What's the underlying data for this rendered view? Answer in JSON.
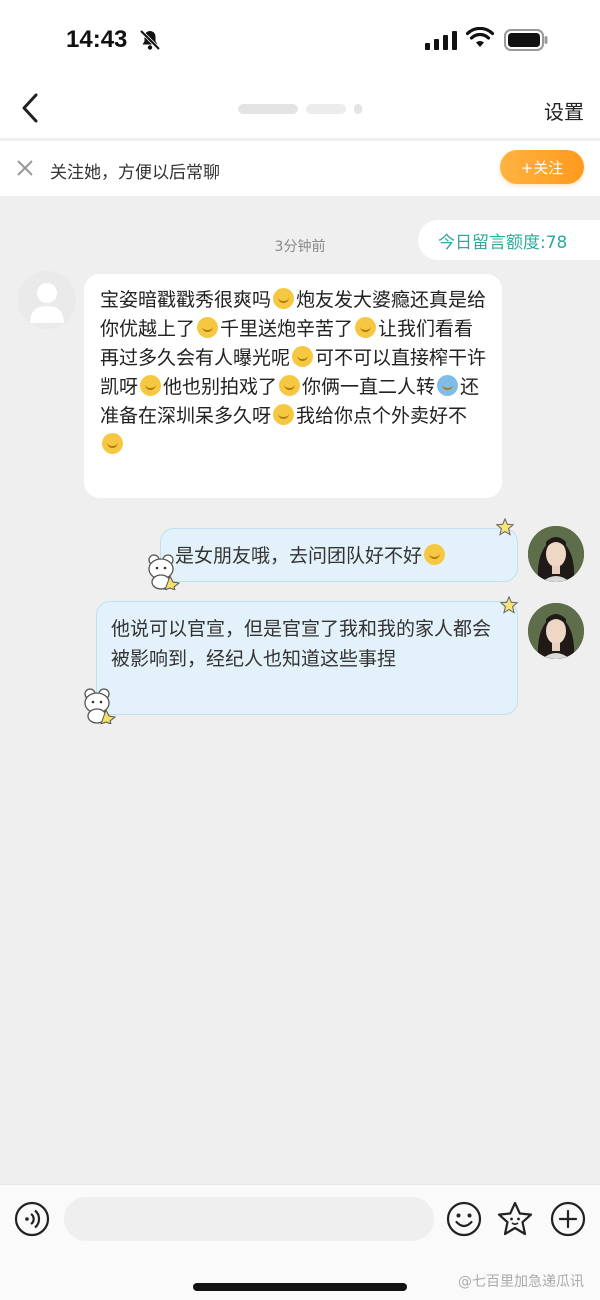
{
  "status_bar": {
    "time": "14:43"
  },
  "nav": {
    "settings_label": "设置"
  },
  "follow_banner": {
    "text": "关注她，方便以后常聊",
    "follow_label": "+关注"
  },
  "chat": {
    "timestamp": "3分钟前",
    "quota_text": "今日留言额度:78",
    "received_message": {
      "segments": [
        "宝姿暗戳戳秀很爽吗",
        "炮友发大婆瘾还真是给你优越上了",
        "千里送炮辛苦了",
        "让我们看看再过多久会有人曝光呢",
        "可不可以直接榨干许凯呀",
        "他也别拍戏了",
        "你俩一直二人转",
        "还准备在深圳呆多久呀",
        "我给你点个外卖好不"
      ]
    },
    "sent_messages": [
      {
        "text": "是女朋友哦，去问团队好不好"
      },
      {
        "text": "他说可以官宣，但是官宣了我和我的家人都会被影响到，经纪人也知道这些事捏"
      }
    ]
  },
  "input_bar": {
    "placeholder": ""
  },
  "watermark": "@七百里加急递瓜讯",
  "colors": {
    "accent_orange": "#ff9a1e",
    "quota_teal": "#2ea99c",
    "sent_bubble": "#e3f2fa",
    "background": "#efefef"
  },
  "icons": [
    "bell-mute-icon",
    "signal-icon",
    "wifi-icon",
    "battery-icon",
    "back-arrow-icon",
    "close-icon",
    "voice-icon",
    "emoji-icon",
    "sticker-icon",
    "plus-icon"
  ]
}
